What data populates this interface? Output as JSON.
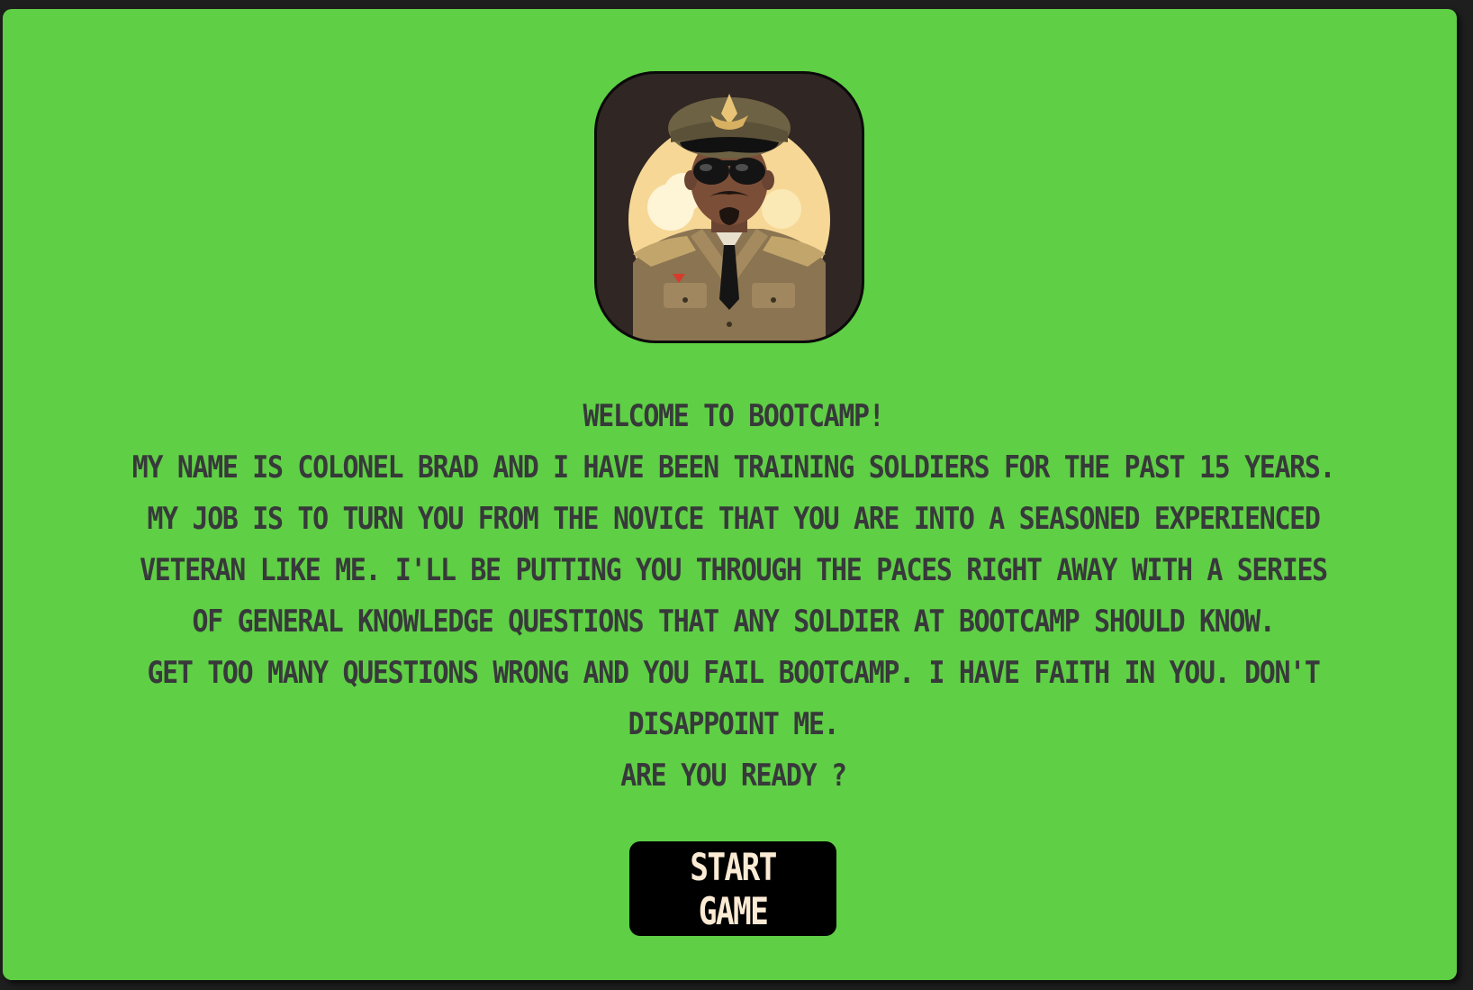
{
  "welcome": {
    "avatar_icon": "colonel-brad-avatar-icon",
    "heading": "Welcome to bootcamp!",
    "paragraph_1": "My name is Colonel Brad and I have been training soldiers for the past 15 years. My job is to turn you from the novice that you are into a seasoned experienced veteran like me. I'll be putting you through the paces right away with a series of general knowledge questions that any soldier at bootcamp should know.",
    "paragraph_2": "Get too many questions wrong and you fail bootcamp. I have faith in you. Don't disappoint me.",
    "paragraph_3": "Are you ready ?",
    "start_label": "Start Game"
  },
  "colors": {
    "background": "#5fcf45",
    "text": "#37393a",
    "button_bg": "#000000",
    "button_text": "#fbead4"
  }
}
